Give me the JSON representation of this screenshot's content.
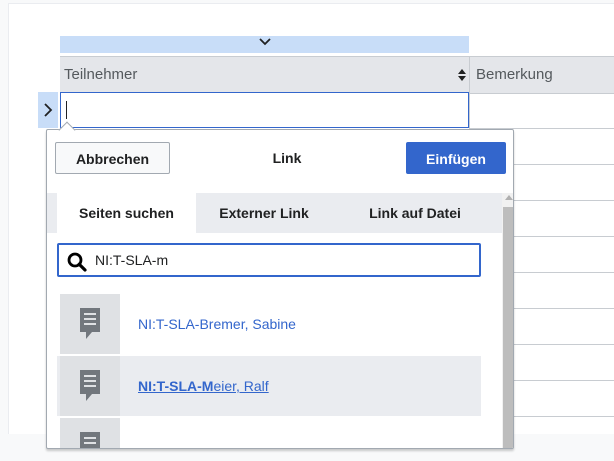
{
  "table": {
    "columns": [
      "Teilnehmer",
      "Bemerkung"
    ],
    "active_cell_value": ""
  },
  "icons": {
    "column_menu": "chevron-down-icon",
    "sort": "sort-icon",
    "row_handle": "chevron-right-icon",
    "search": "search-icon",
    "page": "page-icon"
  },
  "dialog": {
    "cancel_label": "Abbrechen",
    "title": "Link",
    "insert_label": "Einfügen",
    "tabs": [
      "Seiten suchen",
      "Externer Link",
      "Link auf Datei"
    ],
    "active_tab": "Seiten suchen",
    "search_value": "NI:T-SLA-m",
    "results": [
      {
        "title": "NI:T-SLA-Bremer, Sabine"
      },
      {
        "title_match": "NI:T-SLA-M",
        "title_rest": "eier, Ralf",
        "selected": true
      },
      {
        "title": ""
      }
    ]
  },
  "colors": {
    "accent": "#3366cc",
    "column_toolbar": "#c8ddf8",
    "header_bg": "#e4e6ea",
    "selected_row": "#eaecf0"
  }
}
